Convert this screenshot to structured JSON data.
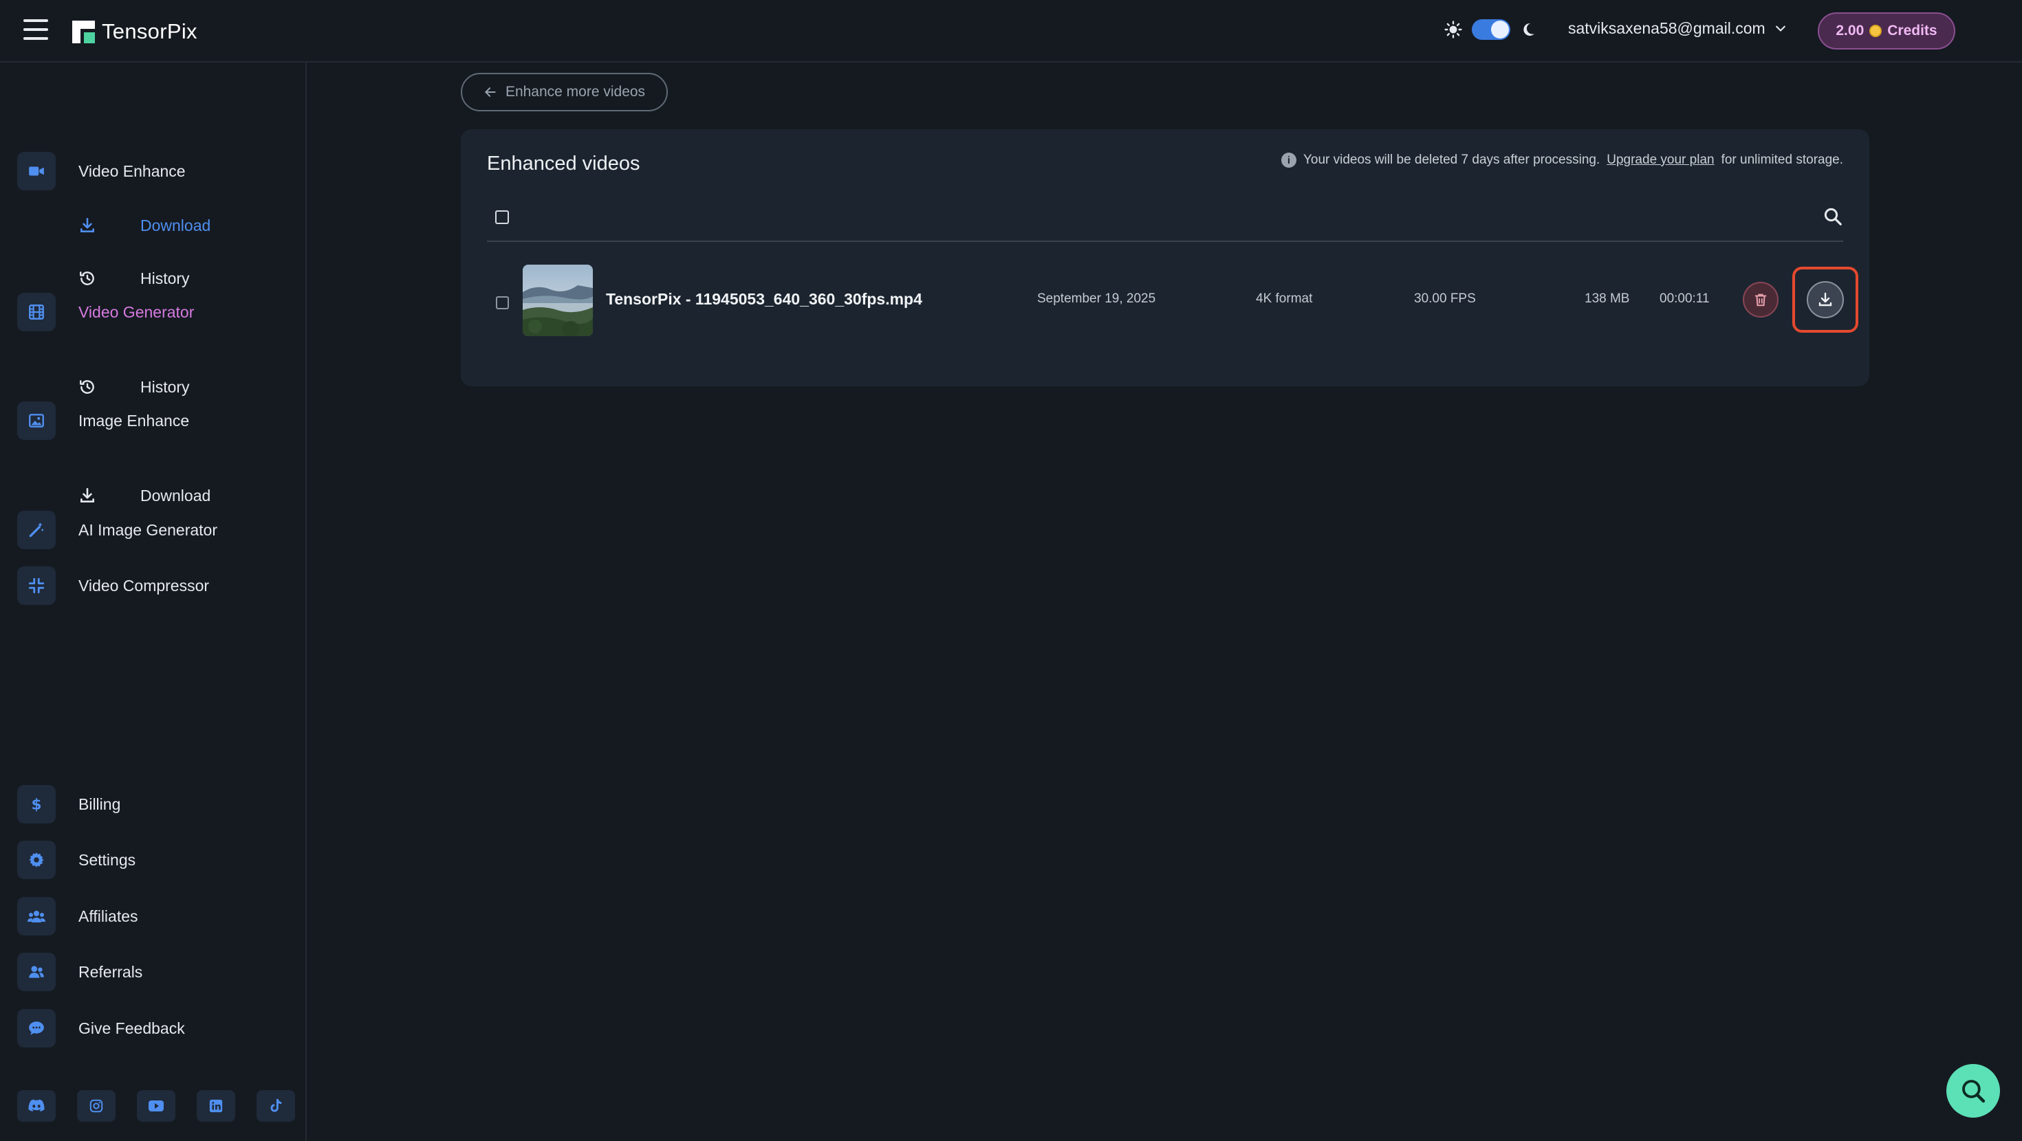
{
  "header": {
    "logo_text": "TensorPix",
    "user_email": "satviksaxena58@gmail.com",
    "credits_amount": "2.00",
    "credits_label": "Credits",
    "theme": "dark",
    "accent_color": "#3a7be0",
    "credits_color": "#f0b9f3"
  },
  "sidebar": {
    "video_enhance": "Video Enhance",
    "video_enhance_download": "Download",
    "video_enhance_history": "History",
    "video_generator": "Video Generator",
    "video_generator_history": "History",
    "image_enhance": "Image Enhance",
    "image_enhance_download": "Download",
    "ai_image_generator": "AI Image Generator",
    "video_compressor": "Video Compressor",
    "billing": "Billing",
    "settings": "Settings",
    "affiliates": "Affiliates",
    "referrals": "Referrals",
    "give_feedback": "Give Feedback",
    "socials": [
      "discord-icon",
      "instagram-icon",
      "youtube-icon",
      "linkedin-icon",
      "tiktok-icon"
    ]
  },
  "main": {
    "back_button": "Enhance more videos",
    "panel_title": "Enhanced videos",
    "notice_prefix": "Your videos will be deleted 7 days after processing.",
    "notice_link": "Upgrade your plan",
    "notice_suffix": "for unlimited storage.",
    "videos": [
      {
        "filename": "TensorPix - 11945053_640_360_30fps.mp4",
        "date": "September 19, 2025",
        "format": "4K format",
        "fps": "30.00 FPS",
        "size": "138 MB",
        "duration": "00:00:11"
      }
    ]
  }
}
